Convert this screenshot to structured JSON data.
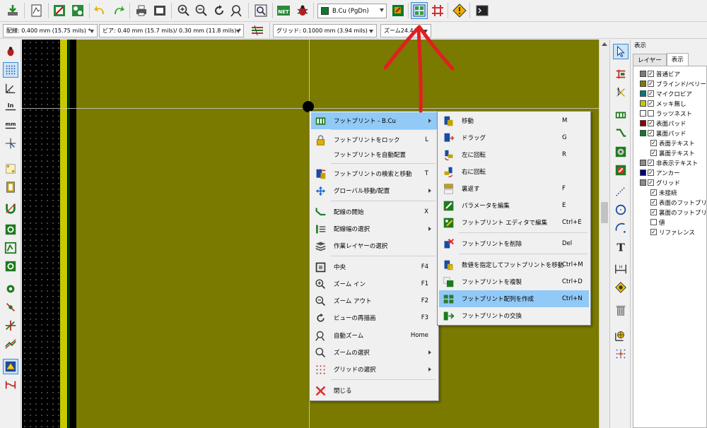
{
  "toolbar": {
    "icons": [
      "save-board-icon",
      "page-settings-icon",
      "open-library-icon",
      "load-netlist-icon",
      "undo-icon",
      "redo-icon",
      "print-icon",
      "plot-icon",
      "zoom-in-icon",
      "zoom-out-icon",
      "redraw-icon",
      "zoom-fit-icon",
      "find-icon",
      "netlist-icon",
      "drc-bug-icon",
      "layer-pair-icon",
      "grid-array-icon",
      "autoroute-icon",
      "drc-warning-icon",
      "scripting-console-icon"
    ],
    "active_layer": "B.Cu (PgDn)",
    "active_layer_color": "#0b7a2c"
  },
  "toolbar2": {
    "track_width": "配線: 0.400 mm (15.75 mils) *",
    "via_size": "ビア: 0.40 mm (15.7 mils)/ 0.30 mm (11.8 mils) *",
    "grid": "グリッド: 0.1000 mm (3.94 mils)",
    "zoom": "ズーム24.44"
  },
  "menu1": {
    "items": [
      {
        "label": "フットプリント - B.Cu",
        "shortcut": "",
        "icon": "footprint-icon",
        "submenu": true,
        "highlight": true
      },
      {
        "label": "フットプリントをロック",
        "shortcut": "L",
        "icon": "lock-icon"
      },
      {
        "label": "フットプリントを自動配置",
        "shortcut": "",
        "icon": ""
      },
      {
        "label": "フットプリントの検索と移動",
        "shortcut": "T",
        "icon": "find-move-icon"
      },
      {
        "label": "グローバル移動/配置",
        "shortcut": "",
        "icon": "global-move-icon",
        "submenu": true
      },
      {
        "label": "配線の開始",
        "shortcut": "X",
        "icon": "route-track-icon"
      },
      {
        "label": "配線幅の選択",
        "shortcut": "",
        "icon": "track-width-icon",
        "submenu": true
      },
      {
        "label": "作業レイヤーの選択",
        "shortcut": "",
        "icon": "layers-icon"
      },
      {
        "label": "中央",
        "shortcut": "F4",
        "icon": "center-icon"
      },
      {
        "label": "ズーム イン",
        "shortcut": "F1",
        "icon": "zoom-in-icon"
      },
      {
        "label": "ズーム アウト",
        "shortcut": "F2",
        "icon": "zoom-out-icon"
      },
      {
        "label": "ビューの再描画",
        "shortcut": "F3",
        "icon": "redraw-icon"
      },
      {
        "label": "自動ズーム",
        "shortcut": "Home",
        "icon": "zoom-fit-icon"
      },
      {
        "label": "ズームの選択",
        "shortcut": "",
        "icon": "zoom-select-icon",
        "submenu": true
      },
      {
        "label": "グリッドの選択",
        "shortcut": "",
        "icon": "grid-select-icon",
        "submenu": true
      },
      {
        "label": "閉じる",
        "shortcut": "",
        "icon": "close-icon"
      }
    ]
  },
  "menu2": {
    "items": [
      {
        "label": "移動",
        "shortcut": "M",
        "icon": "move-icon"
      },
      {
        "label": "ドラッグ",
        "shortcut": "G",
        "icon": "drag-icon"
      },
      {
        "label": "左に回転",
        "shortcut": "R",
        "icon": "rotate-left-icon"
      },
      {
        "label": "右に回転",
        "shortcut": "",
        "icon": "rotate-right-icon"
      },
      {
        "label": "裏返す",
        "shortcut": "F",
        "icon": "flip-icon"
      },
      {
        "label": "パラメータを編集",
        "shortcut": "E",
        "icon": "edit-params-icon"
      },
      {
        "label": "フットプリント エディタで編集",
        "shortcut": "Ctrl+E",
        "icon": "footprint-editor-icon"
      },
      {
        "label": "フットプリントを削除",
        "shortcut": "Del",
        "icon": "delete-icon"
      },
      {
        "label": "数値を指定してフットプリントを移動",
        "shortcut": "Ctrl+M",
        "icon": "move-exact-icon"
      },
      {
        "label": "フットプリントを複製",
        "shortcut": "Ctrl+D",
        "icon": "duplicate-icon"
      },
      {
        "label": "フットプリント配列を作成",
        "shortcut": "Ctrl+N",
        "icon": "array-icon",
        "highlight": true
      },
      {
        "label": "フットプリントの交換",
        "shortcut": "",
        "icon": "exchange-icon"
      }
    ]
  },
  "panel": {
    "title": "表示",
    "tabs": [
      "レイヤー",
      "表示"
    ],
    "layers": [
      {
        "label": "普通ビア",
        "color": "#7a7a7a",
        "checked": true,
        "indent": false
      },
      {
        "label": "ブラインド/ベリードビア",
        "color": "#7a7a00",
        "checked": true,
        "indent": false
      },
      {
        "label": "マイクロビア",
        "color": "#007a7a",
        "checked": true,
        "indent": false
      },
      {
        "label": "メッキ無し",
        "color": "#c8c800",
        "checked": true,
        "indent": false
      },
      {
        "label": "ラッツネスト",
        "color": "#ffffff",
        "checked": false,
        "indent": false
      },
      {
        "label": "表面パッド",
        "color": "#8b0000",
        "checked": true,
        "indent": false
      },
      {
        "label": "裏面パッド",
        "color": "#0b7a2c",
        "checked": true,
        "indent": false
      },
      {
        "label": "表面テキスト",
        "color": "",
        "checked": true,
        "indent": true
      },
      {
        "label": "裏面テキスト",
        "color": "",
        "checked": true,
        "indent": true
      },
      {
        "label": "非表示テキスト",
        "color": "#8a8a8a",
        "checked": true,
        "indent": false
      },
      {
        "label": "アンカー",
        "color": "#00007a",
        "checked": true,
        "indent": false
      },
      {
        "label": "グリッド",
        "color": "#8a8a8a",
        "checked": true,
        "indent": false
      },
      {
        "label": "未接続",
        "color": "",
        "checked": true,
        "indent": true
      },
      {
        "label": "表面のフットプリント",
        "color": "",
        "checked": true,
        "indent": true
      },
      {
        "label": "裏面のフットプリント",
        "color": "",
        "checked": true,
        "indent": true
      },
      {
        "label": "値",
        "color": "",
        "checked": false,
        "indent": true
      },
      {
        "label": "リファレンス",
        "color": "",
        "checked": true,
        "indent": true
      }
    ]
  }
}
